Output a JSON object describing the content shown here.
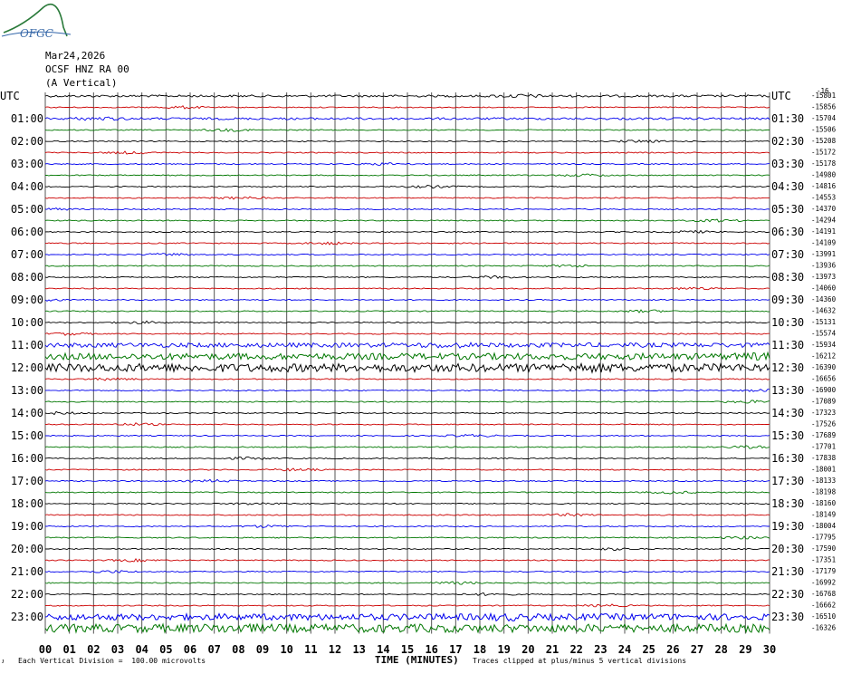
{
  "logo": {
    "text": "OFGC",
    "color": "#2a7a3a"
  },
  "header": {
    "date": "Mar24,2026",
    "station": "OCSF HNZ RA 00",
    "component": "(A Vertical)"
  },
  "footer": {
    "left_mark": "ᴊ",
    "vertical_division": "Each Vertical Division =  100.00 microvolts",
    "clip_note": "Traces clipped at plus/minus 5 vertical divisions"
  },
  "chart_data": {
    "type": "line",
    "title": "",
    "xlabel": "TIME (MINUTES)",
    "ylabel": "",
    "left_axis_title": "UTC",
    "right_axis_title": "UTC",
    "xlim": [
      0,
      30
    ],
    "x_ticks": [
      "00",
      "01",
      "02",
      "03",
      "04",
      "05",
      "06",
      "07",
      "08",
      "09",
      "10",
      "11",
      "12",
      "13",
      "14",
      "15",
      "16",
      "17",
      "18",
      "19",
      "20",
      "21",
      "22",
      "23",
      "24",
      "25",
      "26",
      "27",
      "28",
      "29",
      "30"
    ],
    "trace_colors": [
      "#000000",
      "#cc0000",
      "#0000ee",
      "#007700"
    ],
    "grid": true,
    "left_labels": [
      "UTC",
      "01:00",
      "02:00",
      "03:00",
      "04:00",
      "05:00",
      "06:00",
      "07:00",
      "08:00",
      "09:00",
      "10:00",
      "11:00",
      "12:00",
      "13:00",
      "14:00",
      "15:00",
      "16:00",
      "17:00",
      "18:00",
      "19:00",
      "20:00",
      "21:00",
      "22:00",
      "23:00"
    ],
    "right_labels": [
      "UTC",
      "01:30",
      "02:30",
      "03:30",
      "04:30",
      "05:30",
      "06:30",
      "07:30",
      "08:30",
      "09:30",
      "10:30",
      "11:30",
      "12:30",
      "13:30",
      "14:30",
      "15:30",
      "16:30",
      "17:30",
      "18:30",
      "19:30",
      "20:30",
      "21:30",
      "22:30",
      "23:30"
    ],
    "trace_offsets": [
      "-15801",
      "-15856",
      "-15704",
      "-15506",
      "-15208",
      "-15172",
      "-15178",
      "-14980",
      "-14816",
      "-14553",
      "-14370",
      "-14294",
      "-14191",
      "-14109",
      "-13991",
      "-13936",
      "-13973",
      "-14060",
      "-14360",
      "-14632",
      "-15131",
      "-15574",
      "-15934",
      "-16212",
      "-16390",
      "-16656",
      "-16900",
      "-17089",
      "-17323",
      "-17526",
      "-17689",
      "-17701",
      "-17838",
      "-18001",
      "-18133",
      "-18198",
      "-18160",
      "-18149",
      "-18004",
      "-17795",
      "-17590",
      "-17351",
      "-17179",
      "-16992",
      "-16768",
      "-16662",
      "-16510",
      "-16326"
    ],
    "top_right_extra": "-16",
    "trace_noise_level": [
      1,
      0,
      1,
      0,
      0,
      0,
      0,
      0,
      0,
      0,
      0,
      0,
      0,
      0,
      0,
      0,
      0,
      0,
      0,
      0,
      0,
      0,
      2,
      3,
      4,
      0,
      0,
      0,
      0,
      0,
      0,
      0,
      0,
      0,
      0,
      0,
      0,
      0,
      0,
      0,
      0,
      0,
      0,
      0,
      0,
      0,
      3,
      4
    ]
  }
}
